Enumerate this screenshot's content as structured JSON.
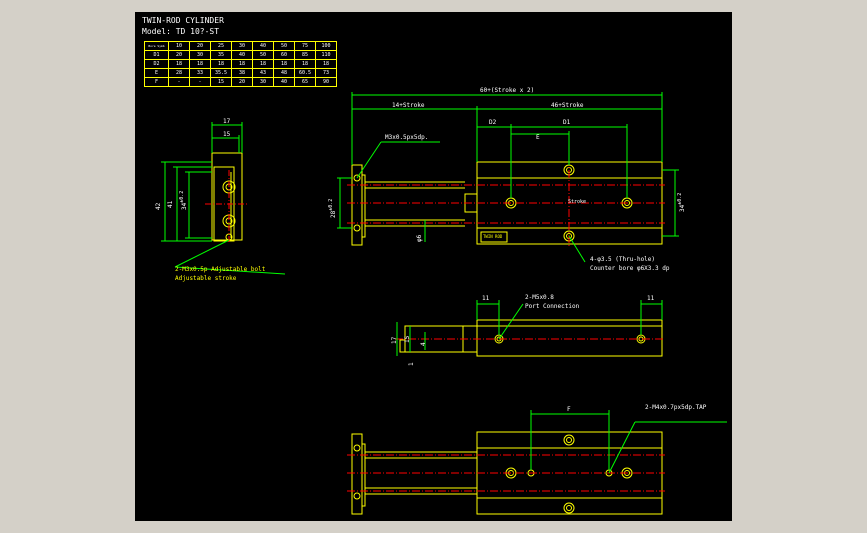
{
  "drawing": {
    "title": "TWIN-ROD CYLINDER",
    "model": "Model: TD 10?-ST"
  },
  "spec_table": {
    "corner": "Bore\nSymb",
    "bores": [
      "10",
      "20",
      "25",
      "30",
      "40",
      "50",
      "75",
      "100"
    ],
    "rows": [
      {
        "sym": "D1",
        "vals": [
          "20",
          "30",
          "35",
          "40",
          "50",
          "60",
          "85",
          "110"
        ]
      },
      {
        "sym": "D2",
        "vals": [
          "18",
          "18",
          "18",
          "18",
          "18",
          "18",
          "18",
          "18"
        ]
      },
      {
        "sym": "E",
        "vals": [
          "28",
          "33",
          "35.5",
          "38",
          "43",
          "48",
          "60.5",
          "73"
        ]
      },
      {
        "sym": "F",
        "vals": [
          "-",
          "-",
          "15",
          "20",
          "30",
          "40",
          "65",
          "90"
        ]
      }
    ]
  },
  "dimensions": {
    "total": "60+(Stroke x 2)",
    "stroke14": "14+Stroke",
    "stroke46": "46+Stroke",
    "d2": "D2",
    "d1": "D1",
    "e": "E",
    "w17": "17",
    "w15": "15",
    "h42": "42",
    "h41": "41",
    "h34": "34",
    "h34b": "34",
    "h28": "28",
    "tol": "±0.2",
    "phi6": "φ6",
    "s11a": "11",
    "s11b": "11",
    "s17": "17",
    "s15": "15",
    "s4": "4",
    "s1": "1",
    "f": "F"
  },
  "callouts": {
    "m3tap": "M3x0.5px5dp.",
    "bolt": "2-M3x0.5p  Adjustable bolt",
    "adj": "Adjustable stroke",
    "thru": "4-φ3.5 (Thru-hole)",
    "cbore": "Counter bore φ6X3.3 dp",
    "port": "2-M5x0.8",
    "portc": "Port Connection",
    "m4": "2-M4x0.7px5dp.TAP",
    "stroke_lbl": "Stroke",
    "plate": "TWIN ROD"
  }
}
